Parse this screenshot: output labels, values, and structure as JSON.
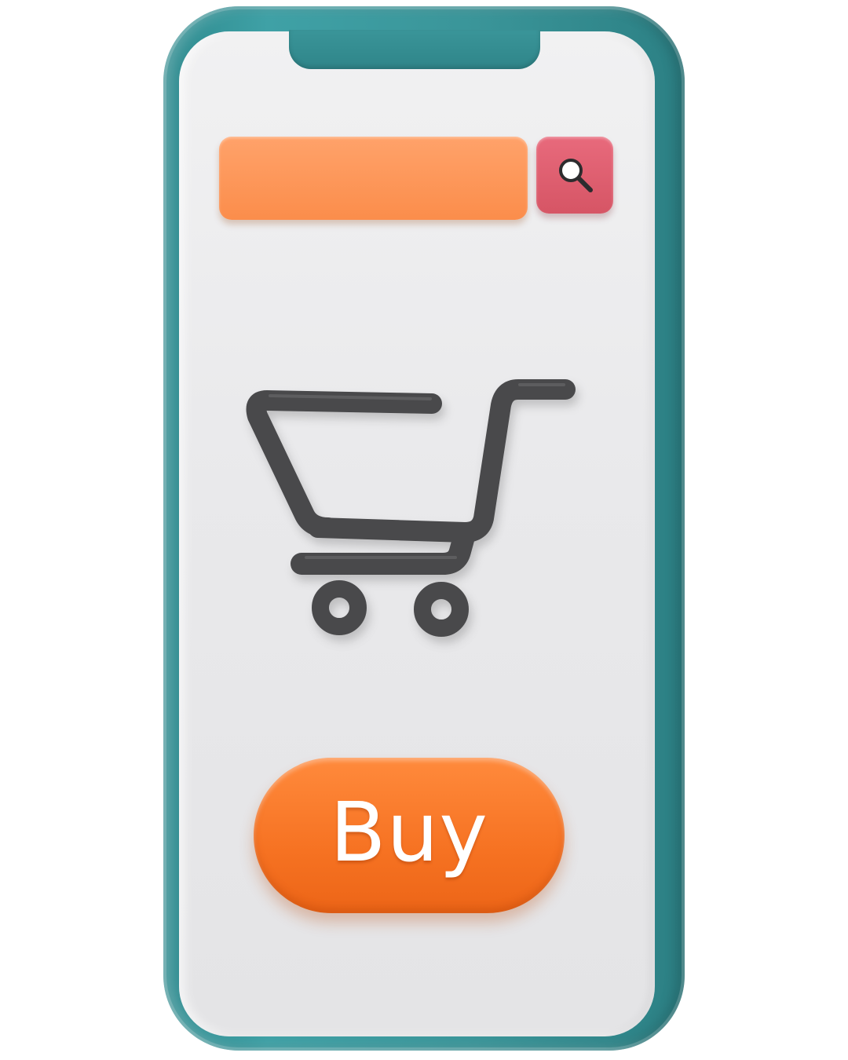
{
  "search": {
    "value": "",
    "placeholder": ""
  },
  "icons": {
    "search": "search-icon",
    "cart": "shopping-cart-icon"
  },
  "buy_button": {
    "label": "Buy"
  },
  "colors": {
    "phone_frame": "#3a9599",
    "screen": "#ebebec",
    "search_bar": "#fd9552",
    "search_button": "#df5f70",
    "buy_button": "#f67222",
    "cart": "#4a4a4c",
    "buy_text": "#ffffff"
  }
}
